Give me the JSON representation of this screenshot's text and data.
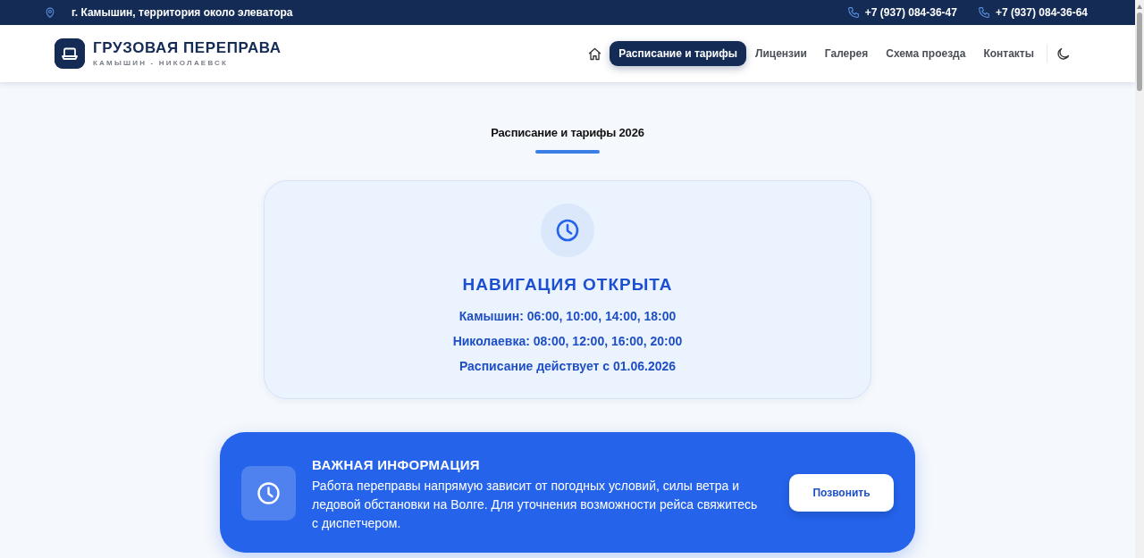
{
  "top_bar": {
    "address": "г. Камышин, территория около элеватора",
    "phones": [
      "+7 (937) 084-36-47",
      "+7 (937) 084-36-64"
    ]
  },
  "header": {
    "logo": {
      "title": "ГРУЗОВАЯ ПЕРЕПРАВА",
      "subtitle": "КАМЫШИН - НИКОЛАЕВСК"
    },
    "nav": [
      {
        "label": "Расписание и тарифы",
        "selected": true
      },
      {
        "label": "Лицензии",
        "selected": false
      },
      {
        "label": "Галерея",
        "selected": false
      },
      {
        "label": "Схема проезда",
        "selected": false
      },
      {
        "label": "Контакты",
        "selected": false
      }
    ]
  },
  "section": {
    "title": "Расписание и тарифы 2026"
  },
  "status_card": {
    "title": "НАВИГАЦИЯ ОТКРЫТА",
    "lines": [
      "Камышин: 06:00, 10:00, 14:00, 18:00",
      "Николаевка: 08:00, 12:00, 16:00, 20:00",
      "Расписание действует с 01.06.2026"
    ]
  },
  "notice": {
    "title": "ВАЖНАЯ ИНФОРМАЦИЯ",
    "text": "Работа переправы напрямую зависит от погодных условий, силы ветра и ледовой обстановки на Волге. Для уточнения возможности рейса свяжитесь с диспетчером.",
    "button": "Позвонить"
  }
}
